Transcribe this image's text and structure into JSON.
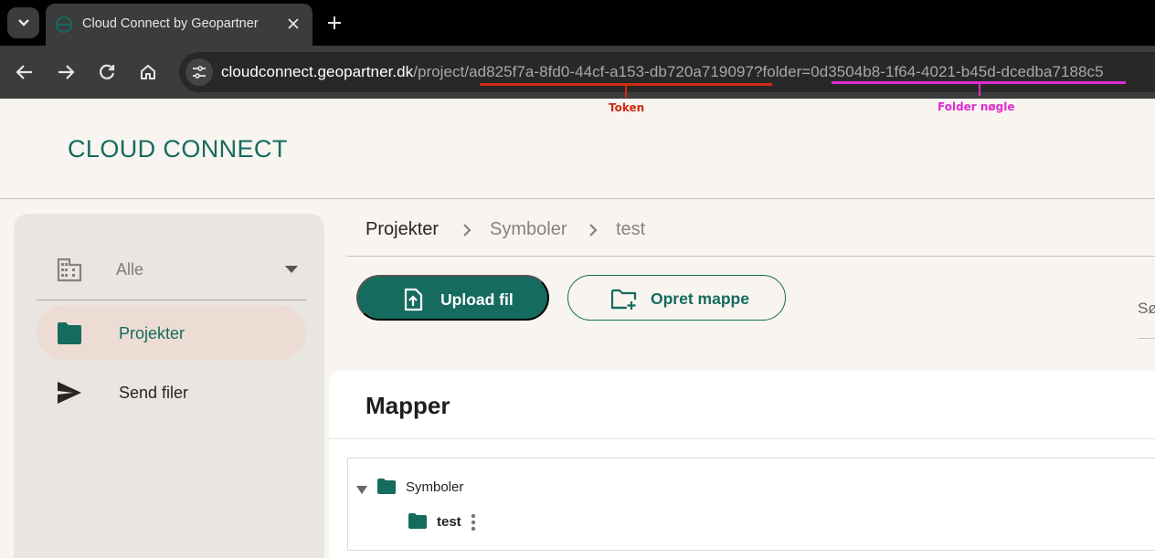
{
  "browser": {
    "tab_title": "Cloud Connect by Geopartner",
    "url_host": "cloudconnect.geopartner.dk",
    "url_path_prefix": "/project/",
    "url_token": "ad825f7a-8fd0-44cf-a153-db720a719097",
    "url_query_prefix": "?folder=",
    "url_folder": "0d3504b8-1f64-4021-b45d-dcedba7188c5"
  },
  "annotations": {
    "token_label": "Token",
    "token_color": "#d32a12",
    "folder_label": "Folder nøgle",
    "folder_color": "#e02bd2"
  },
  "app": {
    "logo": "CLOUD CONNECT",
    "accent": "#156b5e"
  },
  "sidebar": {
    "org_selector": "Alle",
    "items": [
      {
        "label": "Projekter",
        "icon": "folder-icon",
        "active": true
      },
      {
        "label": "Send filer",
        "icon": "send-icon",
        "active": false
      }
    ]
  },
  "breadcrumb": [
    "Projekter",
    "Symboler",
    "test"
  ],
  "actions": {
    "upload_label": "Upload fil",
    "create_folder_label": "Opret mappe"
  },
  "search": {
    "label_partial": "Sø"
  },
  "folders": {
    "title": "Mapper",
    "tree": [
      {
        "name": "Symboler",
        "expanded": true,
        "children": [
          {
            "name": "test",
            "selected": true
          }
        ]
      }
    ]
  }
}
